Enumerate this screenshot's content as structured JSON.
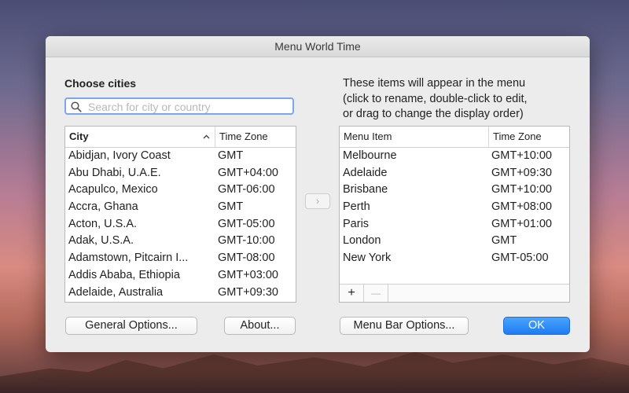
{
  "window": {
    "title": "Menu World Time"
  },
  "left": {
    "heading": "Choose cities",
    "search": {
      "placeholder": "Search for city or country",
      "value": ""
    },
    "columns": {
      "city": "City",
      "timezone": "Time Zone"
    },
    "rows": [
      {
        "city": "Abidjan, Ivory Coast",
        "tz": "GMT"
      },
      {
        "city": "Abu Dhabi, U.A.E.",
        "tz": "GMT+04:00"
      },
      {
        "city": "Acapulco, Mexico",
        "tz": "GMT-06:00"
      },
      {
        "city": "Accra, Ghana",
        "tz": "GMT"
      },
      {
        "city": "Acton, U.S.A.",
        "tz": "GMT-05:00"
      },
      {
        "city": "Adak, U.S.A.",
        "tz": "GMT-10:00"
      },
      {
        "city": "Adamstown, Pitcairn I...",
        "tz": "GMT-08:00"
      },
      {
        "city": "Addis Ababa, Ethiopia",
        "tz": "GMT+03:00"
      },
      {
        "city": "Adelaide, Australia",
        "tz": "GMT+09:30"
      }
    ]
  },
  "right": {
    "description": [
      "These items will appear in the menu",
      "(click to rename, double-click to edit,",
      "or drag to change the display order)"
    ],
    "columns": {
      "item": "Menu Item",
      "timezone": "Time Zone"
    },
    "rows": [
      {
        "item": "Melbourne",
        "tz": "GMT+10:00"
      },
      {
        "item": "Adelaide",
        "tz": "GMT+09:30"
      },
      {
        "item": "Brisbane",
        "tz": "GMT+10:00"
      },
      {
        "item": "Perth",
        "tz": "GMT+08:00"
      },
      {
        "item": "Paris",
        "tz": "GMT+01:00"
      },
      {
        "item": "London",
        "tz": "GMT"
      },
      {
        "item": "New York",
        "tz": "GMT-05:00"
      }
    ],
    "add_label": "+",
    "remove_label": "—"
  },
  "buttons": {
    "general": "General Options...",
    "about": "About...",
    "menubar": "Menu Bar Options...",
    "ok": "OK",
    "move": "›"
  },
  "icons": {
    "search": "magnifier-icon",
    "sort": "chevron-up-icon"
  },
  "colors": {
    "accent": "#1e7cf0",
    "focus_ring": "#7aa7e8"
  }
}
